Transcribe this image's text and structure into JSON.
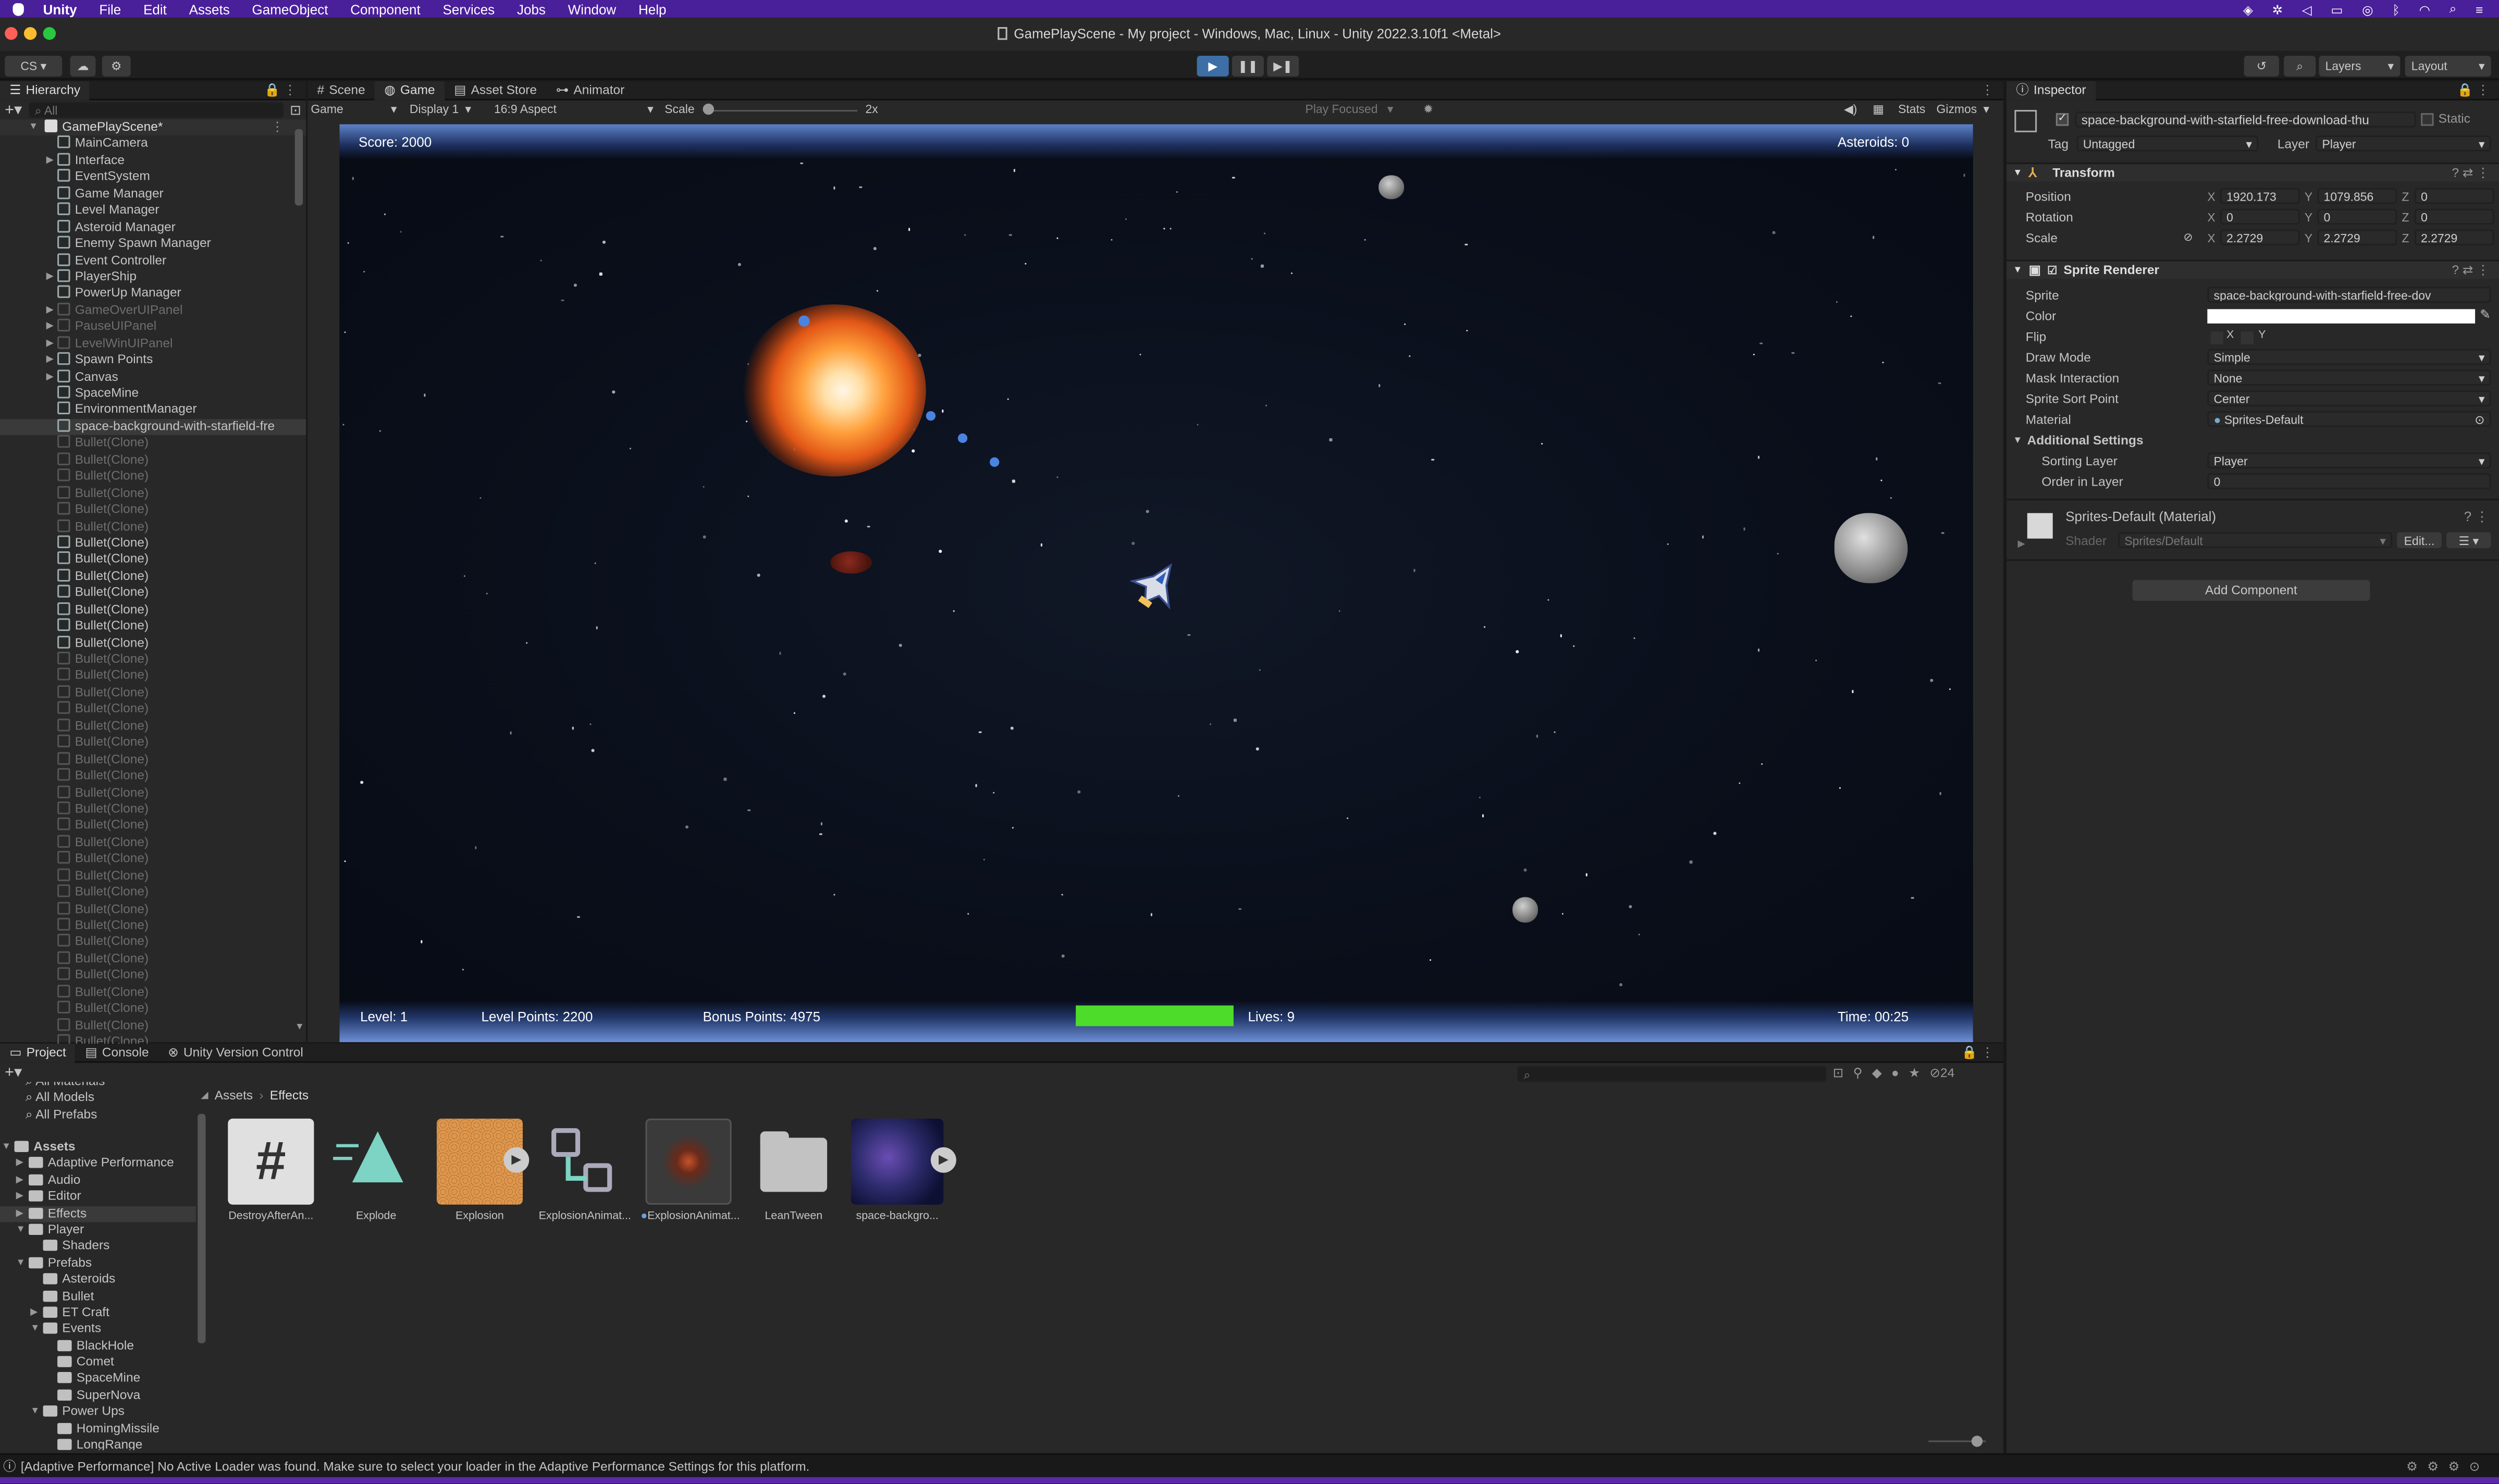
{
  "os_menu": {
    "apple": "",
    "app": "Unity",
    "items": [
      "File",
      "Edit",
      "Assets",
      "GameObject",
      "Component",
      "Services",
      "Jobs",
      "Window",
      "Help"
    ]
  },
  "window_title": "GamePlayScene - My project - Windows, Mac, Linux - Unity 2022.3.10f1 <Metal>",
  "toolbar": {
    "account": "CS",
    "layers": "Layers",
    "layout": "Layout"
  },
  "hierarchy": {
    "tab": "Hierarchy",
    "search_placeholder": "All",
    "scene": "GamePlayScene*",
    "items": [
      {
        "label": "MainCamera",
        "dim": false,
        "arrow": false
      },
      {
        "label": "Interface",
        "dim": false,
        "arrow": true
      },
      {
        "label": "EventSystem",
        "dim": false,
        "arrow": false
      },
      {
        "label": "Game Manager",
        "dim": false,
        "arrow": false
      },
      {
        "label": "Level Manager",
        "dim": false,
        "arrow": false
      },
      {
        "label": "Asteroid Manager",
        "dim": false,
        "arrow": false
      },
      {
        "label": "Enemy Spawn Manager",
        "dim": false,
        "arrow": false
      },
      {
        "label": "Event Controller",
        "dim": false,
        "arrow": false
      },
      {
        "label": "PlayerShip",
        "dim": false,
        "arrow": true
      },
      {
        "label": "PowerUp Manager",
        "dim": false,
        "arrow": false
      },
      {
        "label": "GameOverUIPanel",
        "dim": true,
        "arrow": true
      },
      {
        "label": "PauseUIPanel",
        "dim": true,
        "arrow": true
      },
      {
        "label": "LevelWinUIPanel",
        "dim": true,
        "arrow": true
      },
      {
        "label": "Spawn Points",
        "dim": false,
        "arrow": true
      },
      {
        "label": "Canvas",
        "dim": false,
        "arrow": true
      },
      {
        "label": "SpaceMine",
        "dim": false,
        "arrow": false
      },
      {
        "label": "EnvironmentManager",
        "dim": false,
        "arrow": false
      },
      {
        "label": "space-background-with-starfield-fre",
        "dim": false,
        "arrow": false,
        "selected": true
      },
      {
        "label": "Bullet(Clone)",
        "dim": true
      },
      {
        "label": "Bullet(Clone)",
        "dim": true
      },
      {
        "label": "Bullet(Clone)",
        "dim": true
      },
      {
        "label": "Bullet(Clone)",
        "dim": true
      },
      {
        "label": "Bullet(Clone)",
        "dim": true
      },
      {
        "label": "Bullet(Clone)",
        "dim": true
      },
      {
        "label": "Bullet(Clone)",
        "dim": false
      },
      {
        "label": "Bullet(Clone)",
        "dim": false
      },
      {
        "label": "Bullet(Clone)",
        "dim": false
      },
      {
        "label": "Bullet(Clone)",
        "dim": false
      },
      {
        "label": "Bullet(Clone)",
        "dim": false
      },
      {
        "label": "Bullet(Clone)",
        "dim": false
      },
      {
        "label": "Bullet(Clone)",
        "dim": false
      },
      {
        "label": "Bullet(Clone)",
        "dim": true
      },
      {
        "label": "Bullet(Clone)",
        "dim": true
      },
      {
        "label": "Bullet(Clone)",
        "dim": true
      },
      {
        "label": "Bullet(Clone)",
        "dim": true
      },
      {
        "label": "Bullet(Clone)",
        "dim": true
      },
      {
        "label": "Bullet(Clone)",
        "dim": true
      },
      {
        "label": "Bullet(Clone)",
        "dim": true
      },
      {
        "label": "Bullet(Clone)",
        "dim": true
      },
      {
        "label": "Bullet(Clone)",
        "dim": true
      },
      {
        "label": "Bullet(Clone)",
        "dim": true
      },
      {
        "label": "Bullet(Clone)",
        "dim": true
      },
      {
        "label": "Bullet(Clone)",
        "dim": true
      },
      {
        "label": "Bullet(Clone)",
        "dim": true
      },
      {
        "label": "Bullet(Clone)",
        "dim": true
      },
      {
        "label": "Bullet(Clone)",
        "dim": true
      },
      {
        "label": "Bullet(Clone)",
        "dim": true
      },
      {
        "label": "Bullet(Clone)",
        "dim": true
      },
      {
        "label": "Bullet(Clone)",
        "dim": true
      },
      {
        "label": "Bullet(Clone)",
        "dim": true
      },
      {
        "label": "Bullet(Clone)",
        "dim": true
      },
      {
        "label": "Bullet(Clone)",
        "dim": true
      },
      {
        "label": "Bullet(Clone)",
        "dim": true
      },
      {
        "label": "Bullet(Clone)",
        "dim": true
      },
      {
        "label": "Bullet(Clone)",
        "dim": true
      },
      {
        "label": "Bullet(Clone)",
        "dim": true
      },
      {
        "label": "Bullet(Clone)",
        "dim": true
      },
      {
        "label": "Bullet(Clone)",
        "dim": true
      },
      {
        "label": "Bullet(Clone)",
        "dim": true
      }
    ]
  },
  "center_tabs": [
    "Scene",
    "Game",
    "Asset Store",
    "Animator"
  ],
  "game_toolbar": {
    "mode": "Game",
    "display": "Display 1",
    "aspect": "16:9 Aspect",
    "scale_label": "Scale",
    "scale_value": "2x",
    "play_focused": "Play Focused",
    "stats": "Stats",
    "gizmos": "Gizmos"
  },
  "hud": {
    "score": "Score: 2000",
    "asteroids": "Asteroids: 0",
    "level": "Level: 1",
    "level_points": "Level Points: 2200",
    "bonus_points": "Bonus Points: 4975",
    "lives": "Lives: 9",
    "time": "Time: 00:25",
    "health_fraction": 1.0
  },
  "inspector": {
    "tab": "Inspector",
    "object_name": "space-background-with-starfield-free-download-thu",
    "static": "Static",
    "tag_label": "Tag",
    "tag": "Untagged",
    "layer_label": "Layer",
    "layer": "Player",
    "transform": {
      "title": "Transform",
      "position": {
        "label": "Position",
        "x": "1920.173",
        "y": "1079.856",
        "z": "0"
      },
      "rotation": {
        "label": "Rotation",
        "x": "0",
        "y": "0",
        "z": "0"
      },
      "scale": {
        "label": "Scale",
        "x": "2.2729",
        "y": "2.2729",
        "z": "2.2729"
      }
    },
    "sprite_renderer": {
      "title": "Sprite Renderer",
      "sprite_label": "Sprite",
      "sprite": "space-background-with-starfield-free-dov",
      "color_label": "Color",
      "flip_label": "Flip",
      "flip_x": "X",
      "flip_y": "Y",
      "draw_mode_label": "Draw Mode",
      "draw_mode": "Simple",
      "mask_label": "Mask Interaction",
      "mask": "None",
      "sort_point_label": "Sprite Sort Point",
      "sort_point": "Center",
      "material_label": "Material",
      "material": "Sprites-Default",
      "additional": "Additional Settings",
      "sorting_layer_label": "Sorting Layer",
      "sorting_layer": "Player",
      "order_label": "Order in Layer",
      "order": "0"
    },
    "material": {
      "title": "Sprites-Default (Material)",
      "shader_label": "Shader",
      "shader": "Sprites/Default",
      "edit": "Edit..."
    },
    "add_component": "Add Component"
  },
  "bottom_tabs": [
    "Project",
    "Console",
    "Unity Version Control"
  ],
  "project": {
    "favorites": [
      "All Materials",
      "All Models",
      "All Prefabs"
    ],
    "tree": [
      {
        "label": "Assets",
        "level": 0,
        "bold": true
      },
      {
        "label": "Adaptive Performance",
        "level": 1
      },
      {
        "label": "Audio",
        "level": 1
      },
      {
        "label": "Editor",
        "level": 1
      },
      {
        "label": "Effects",
        "level": 1,
        "selected": true
      },
      {
        "label": "Player",
        "level": 1
      },
      {
        "label": "Shaders",
        "level": 2
      },
      {
        "label": "Prefabs",
        "level": 1
      },
      {
        "label": "Asteroids",
        "level": 2
      },
      {
        "label": "Bullet",
        "level": 2
      },
      {
        "label": "ET Craft",
        "level": 2
      },
      {
        "label": "Events",
        "level": 2
      },
      {
        "label": "BlackHole",
        "level": 3
      },
      {
        "label": "Comet",
        "level": 3
      },
      {
        "label": "SpaceMine",
        "level": 3
      },
      {
        "label": "SuperNova",
        "level": 3
      },
      {
        "label": "Power Ups",
        "level": 2
      },
      {
        "label": "HomingMissile",
        "level": 3
      },
      {
        "label": "LongRange",
        "level": 3
      }
    ],
    "breadcrumb": [
      "Assets",
      "Effects"
    ],
    "hidden_count": "24",
    "assets": [
      "DestroyAfterAn...",
      "Explode",
      "Explosion",
      "ExplosionAnimat...",
      "ExplosionAnimat...",
      "LeanTween",
      "space-backgro..."
    ]
  },
  "status_bar": "[Adaptive Performance] No Active Loader was found. Make sure to select your loader in the Adaptive Performance Settings for this platform.",
  "colors": {
    "menubar": "#4a1f9a",
    "selection": "#2c5d87",
    "health": "#4ddc2a",
    "accent": "#3d6fa6"
  }
}
